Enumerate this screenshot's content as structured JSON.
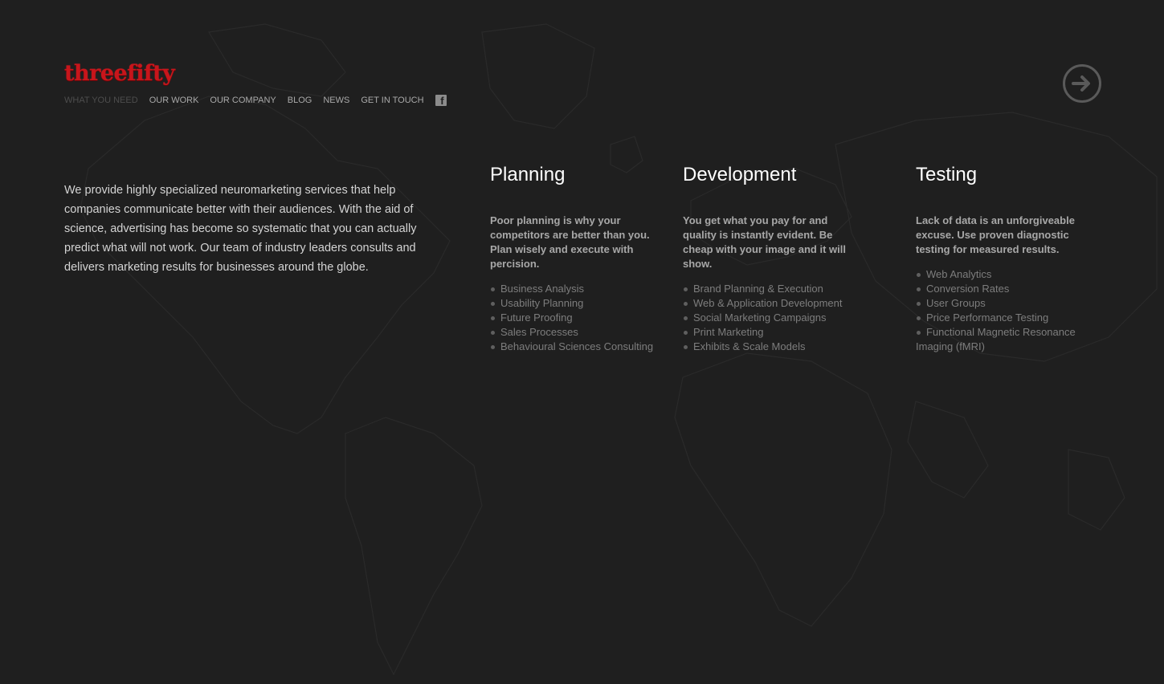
{
  "brand": {
    "logo_text": "threefifty",
    "logo_color": "#c8151b"
  },
  "nav": {
    "items": [
      {
        "label": "WHAT YOU NEED",
        "active": true
      },
      {
        "label": "OUR WORK",
        "active": false
      },
      {
        "label": "OUR COMPANY",
        "active": false
      },
      {
        "label": "BLOG",
        "active": false
      },
      {
        "label": "NEWS",
        "active": false
      },
      {
        "label": "GET IN TOUCH",
        "active": false
      }
    ],
    "social_icon": "facebook-icon",
    "social_glyph": "f"
  },
  "next_button_icon": "arrow-right-icon",
  "intro": "We provide highly specialized neuromarketing services that help companies communicate better with their audiences. With the aid of science, advertising has become so systematic that you can actually predict what will not work. Our team of industry leaders consults and delivers marketing results for businesses around the globe.",
  "columns": [
    {
      "title": "Planning",
      "lead": "Poor planning is why your competitors are better than you. Plan wisely and execute with percision.",
      "items": [
        "Business Analysis",
        "Usability Planning",
        "Future Proofing",
        "Sales Processes",
        "Behavioural Sciences Consulting"
      ]
    },
    {
      "title": "Development",
      "lead": "You get what you pay for and quality is instantly evident. Be cheap with your image and it will show.",
      "items": [
        "Brand Planning & Execution",
        "Web & Application Development",
        "Social Marketing Campaigns",
        "Print Marketing",
        "Exhibits & Scale Models"
      ]
    },
    {
      "title": "Testing",
      "lead": "Lack of data is an unforgiveable excuse. Use proven diagnostic testing for measured results.",
      "items": [
        "Web Analytics",
        "Conversion Rates",
        "User Groups",
        "Price Performance Testing",
        "Functional Magnetic Resonance Imaging (fMRI)"
      ]
    }
  ],
  "colors": {
    "background": "#1f1f1f",
    "heading": "#ffffff",
    "lead_text": "#a8a8a8",
    "list_text": "#7d7d7d",
    "nav_text": "#a9a9a9",
    "nav_active": "#4d4d4d"
  }
}
